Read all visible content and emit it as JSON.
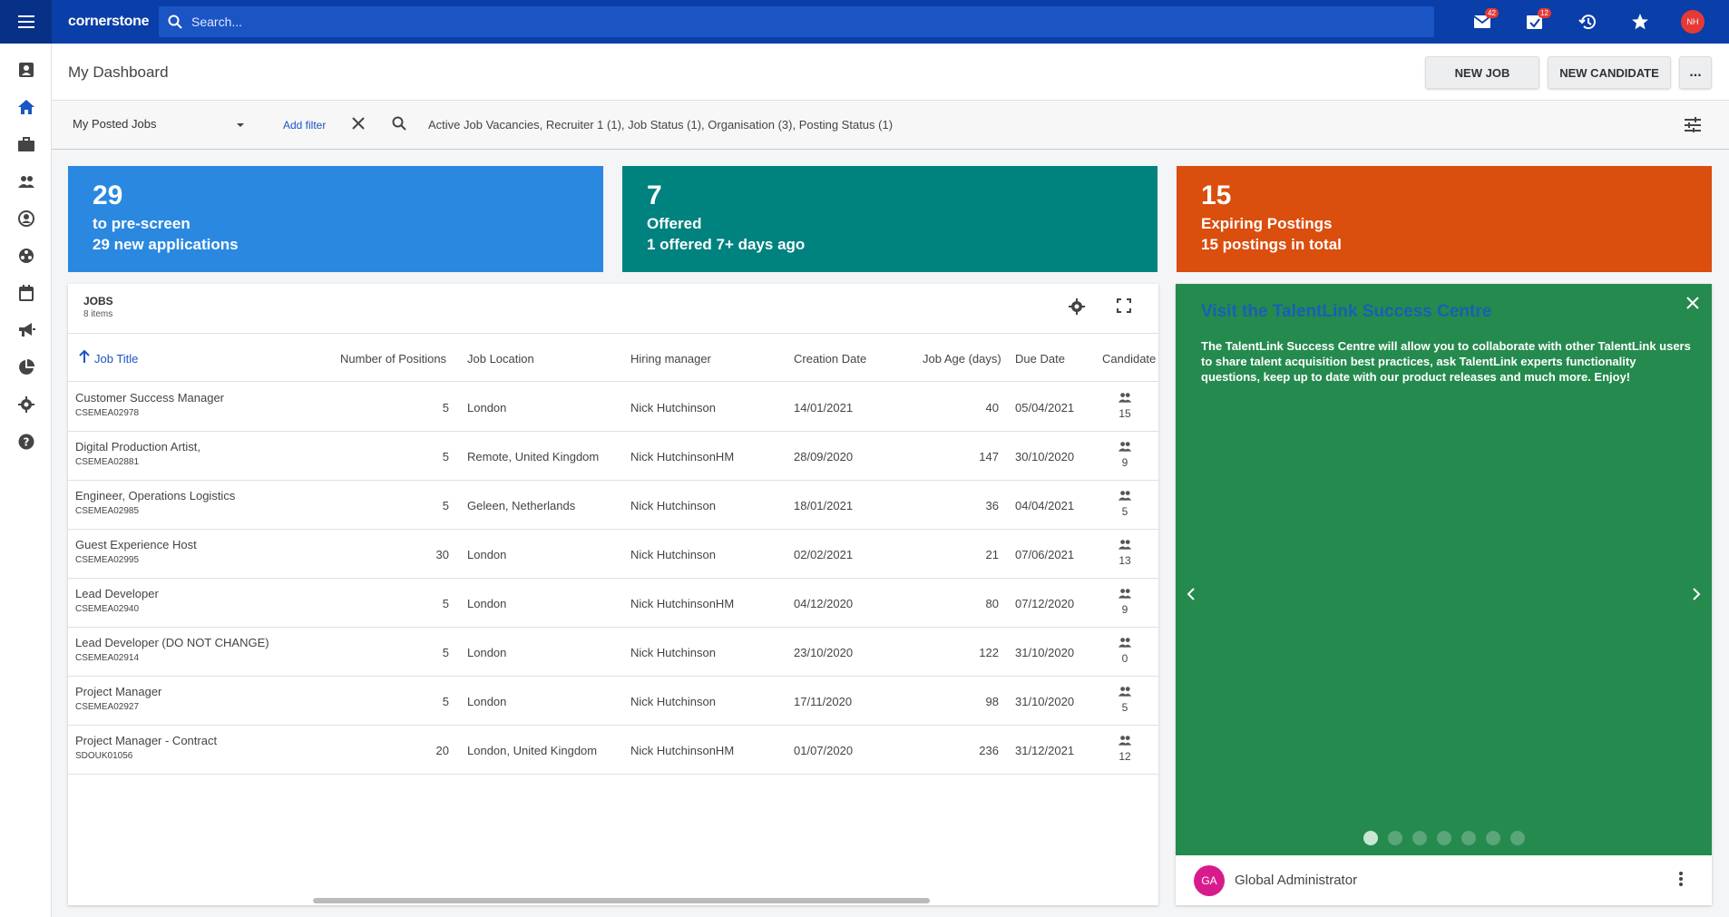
{
  "topbar": {
    "logo": "cornerstone",
    "search_placeholder": "Search...",
    "mail_badge": "42",
    "tasks_badge": "12",
    "user_initials": "NH"
  },
  "header": {
    "title": "My Dashboard",
    "new_job": "NEW JOB",
    "new_candidate": "NEW CANDIDATE",
    "more": "..."
  },
  "filter": {
    "selected": "My Posted Jobs",
    "add_filter": "Add filter",
    "summary": "Active Job Vacancies, Recruiter 1 (1), Job Status (1), Organisation (3), Posting Status (1)"
  },
  "cards": [
    {
      "num": "29",
      "line1": "to pre-screen",
      "line2": "29 new applications",
      "color": "#2b88e0"
    },
    {
      "num": "7",
      "line1": "Offered",
      "line2": "1 offered 7+ days ago",
      "color": "#00827f"
    },
    {
      "num": "15",
      "line1": "Expiring Postings",
      "line2": "15 postings in total",
      "color": "#da4e0e"
    }
  ],
  "jobs": {
    "title": "JOBS",
    "count": "8 items",
    "columns": [
      "Job Title",
      "Number of Positions",
      "Job Location",
      "Hiring manager",
      "Creation Date",
      "Job Age (days)",
      "Due Date",
      "Candidate"
    ],
    "rows": [
      {
        "title": "Customer Success Manager",
        "code": "CSEMEA02978",
        "positions": "5",
        "location": "London",
        "manager": "Nick Hutchinson",
        "created": "14/01/2021",
        "age": "40",
        "due": "05/04/2021",
        "candidates": "15"
      },
      {
        "title": "Digital Production Artist,",
        "code": "CSEMEA02881",
        "positions": "5",
        "location": "Remote, United Kingdom",
        "manager": "Nick HutchinsonHM",
        "created": "28/09/2020",
        "age": "147",
        "due": "30/10/2020",
        "candidates": "9"
      },
      {
        "title": "Engineer, Operations Logistics",
        "code": "CSEMEA02985",
        "positions": "5",
        "location": "Geleen, Netherlands",
        "manager": "Nick Hutchinson",
        "created": "18/01/2021",
        "age": "36",
        "due": "04/04/2021",
        "candidates": "5"
      },
      {
        "title": "Guest Experience Host",
        "code": "CSEMEA02995",
        "positions": "30",
        "location": "London",
        "manager": "Nick Hutchinson",
        "created": "02/02/2021",
        "age": "21",
        "due": "07/06/2021",
        "candidates": "13"
      },
      {
        "title": "Lead Developer",
        "code": "CSEMEA02940",
        "positions": "5",
        "location": "London",
        "manager": "Nick HutchinsonHM",
        "created": "04/12/2020",
        "age": "80",
        "due": "07/12/2020",
        "candidates": "9"
      },
      {
        "title": "Lead Developer (DO NOT CHANGE)",
        "code": "CSEMEA02914",
        "positions": "5",
        "location": "London",
        "manager": "Nick Hutchinson",
        "created": "23/10/2020",
        "age": "122",
        "due": "31/10/2020",
        "candidates": "0"
      },
      {
        "title": "Project Manager",
        "code": "CSEMEA02927",
        "positions": "5",
        "location": "London",
        "manager": "Nick Hutchinson",
        "created": "17/11/2020",
        "age": "98",
        "due": "31/10/2020",
        "candidates": "5"
      },
      {
        "title": "Project Manager - Contract",
        "code": "SDOUK01056",
        "positions": "20",
        "location": "London, United Kingdom",
        "manager": "Nick HutchinsonHM",
        "created": "01/07/2020",
        "age": "236",
        "due": "31/12/2021",
        "candidates": "12"
      }
    ]
  },
  "success": {
    "title": "Visit the TalentLink Success Centre",
    "body": "The TalentLink Success Centre will allow you to collaborate with other TalentLink users to share talent acquisition best practices, ask TalentLink experts functionality questions, keep up to date with our product releases and much more. Enjoy!",
    "author_initials": "GA",
    "author": "Global Administrator",
    "slides": 7,
    "active_slide": 1
  }
}
